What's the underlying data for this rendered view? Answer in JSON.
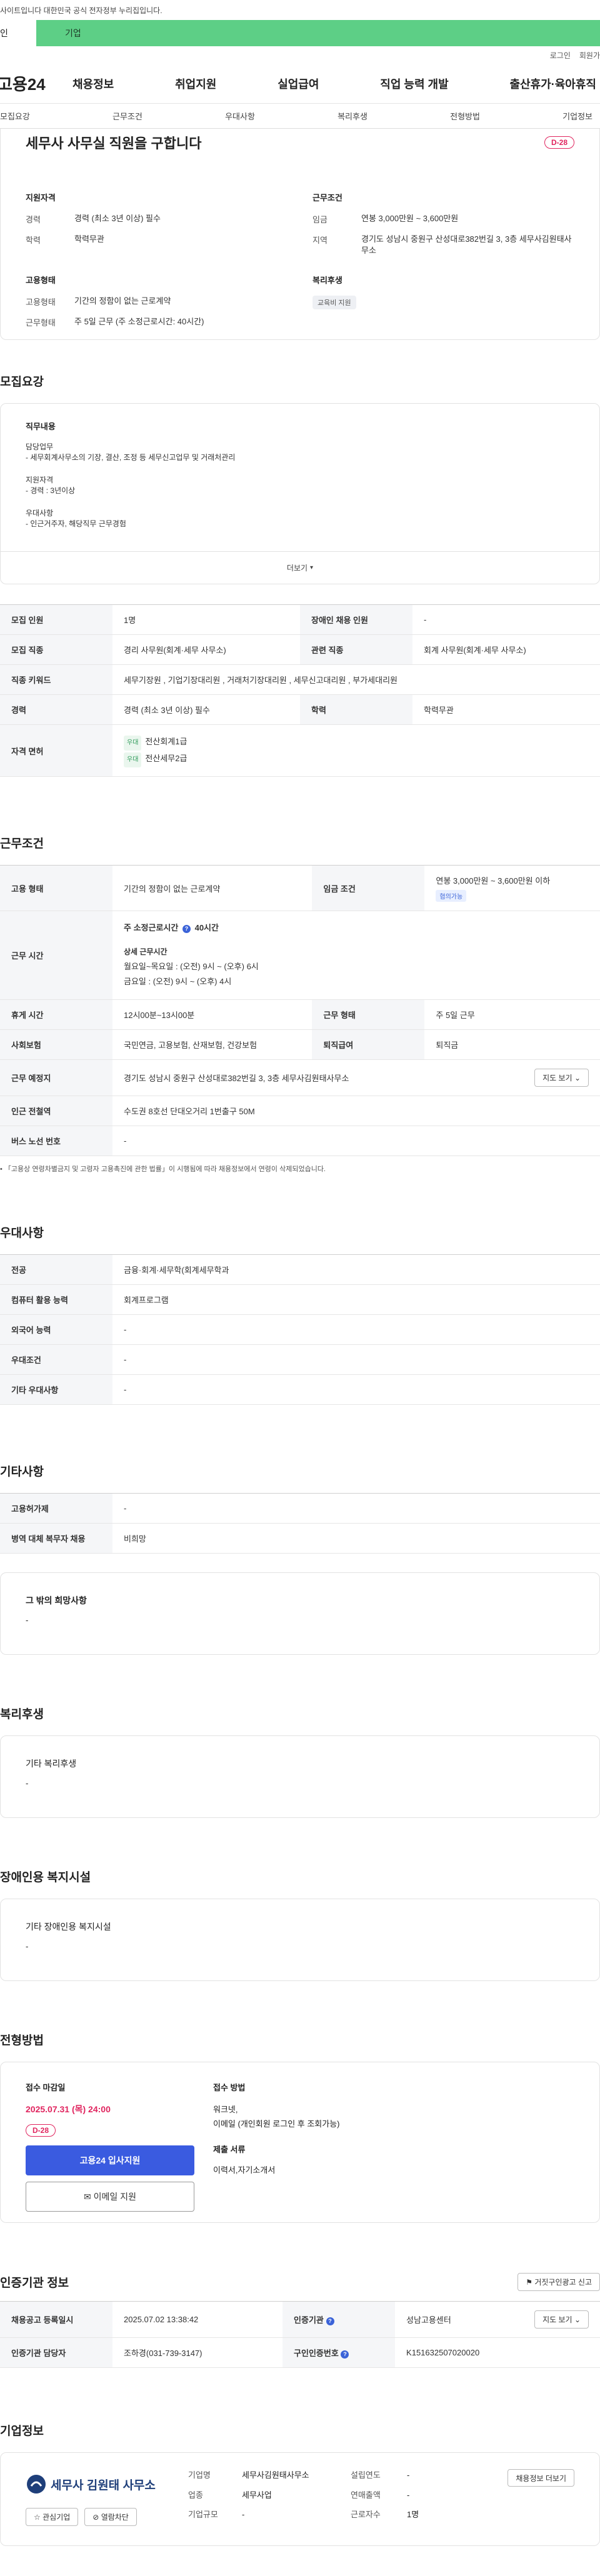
{
  "topbar": {
    "notice": "사이트입니다 대한민국 공식 전자정부 누리집입니다."
  },
  "usertabs": {
    "personal": "인",
    "corporate": "기업"
  },
  "util": {
    "login": "로그인",
    "signup": "회원가"
  },
  "gnb": {
    "logo": "고용24",
    "menu": [
      "채용정보",
      "취업지원",
      "실업급여",
      "직업 능력 개발",
      "출산휴가·육아휴직"
    ]
  },
  "anchors": [
    "모집요강",
    "근무조건",
    "우대사항",
    "복리후생",
    "전형방법",
    "기업정보"
  ],
  "summary": {
    "title": "세무사 사무실 직원을 구합니다",
    "dday": "D-28",
    "qual_title": "지원자격",
    "career_k": "경력",
    "career_v": "경력 (최소 3년 이상) 필수",
    "edu_k": "학력",
    "edu_v": "학력무관",
    "cond_title": "근무조건",
    "pay_k": "임금",
    "pay_v": "연봉 3,000만원 ~ 3,600만원",
    "area_k": "지역",
    "area_v": "경기도 성남시 중원구 산성대로382번길 3, 3층 세무사김원태사무소",
    "emp_title": "고용형태",
    "emptype_k": "고용형태",
    "emptype_v": "기간의 정함이 없는 근로계약",
    "worktype_k": "근무형태",
    "worktype_v": "주 5일 근무 (주 소정근로시간: 40시간)",
    "welfare_title": "복리후생",
    "welfare_chip": "교육비 지원"
  },
  "recruit": {
    "title": "모집요강",
    "duty_title": "직무내용",
    "duty_sub": "담당업무",
    "duty_text": "- 세무회계사무소의 기장, 결산, 조정 등 세무신고업무 및 거래처관리",
    "qual_sub": "지원자격",
    "qual_text": "- 경력 : 3년이상",
    "pref_sub": "우대사항",
    "pref_text": "- 인근거주자, 해당직무 근무경험",
    "more": "더보기",
    "rows": {
      "r1k": "모집 인원",
      "r1v": "1명",
      "r1k2": "장애인 채용 인원",
      "r1v2": "-",
      "r2k": "모집 직종",
      "r2v": "경리 사무원(회계·세무 사무소)",
      "r2k2": "관련 직종",
      "r2v2": "회계 사무원(회계·세무 사무소)",
      "r3k": "직종 키워드",
      "r3v": "세무기장원 , 기업기장대리원 , 거래처기장대리원 , 세무신고대리원 , 부가세대리원",
      "r4k": "경력",
      "r4v": "경력 (최소 3년 이상) 필수",
      "r4k2": "학력",
      "r4v2": "학력무관",
      "r5k": "자격 면허",
      "lic_tag1": "우대",
      "lic1": "전산회계1급",
      "lic_tag2": "우대",
      "lic2": "전산세무2급"
    }
  },
  "workcond": {
    "title": "근무조건",
    "c1k": "고용 형태",
    "c1v": "기간의 정함이 없는 근로계약",
    "c1k2": "임금 조건",
    "c1v2": "연봉 3,000만원 ~ 3,600만원 이하",
    "c1tag": "협의가능",
    "c2k": "근무 시간",
    "c2a": "주 소정근로시간",
    "c2b": "40시간",
    "c2c": "상세 근무시간",
    "c2d": "월요일~목요일 : (오전) 9시 ~ (오후) 6시",
    "c2e": "금요일 : (오전) 9시 ~ (오후) 4시",
    "c3k": "휴게 시간",
    "c3v": "12시00분~13시00분",
    "c3k2": "근무 형태",
    "c3v2": "주 5일 근무",
    "c4k": "사회보험",
    "c4v": "국민연금, 고용보험, 산재보험, 건강보험",
    "c4k2": "퇴직급여",
    "c4v2": "퇴직금",
    "c5k": "근무 예정지",
    "c5v": "경기도 성남시 중원구 산성대로382번길 3, 3층 세무사김원태사무소",
    "c5btn": "지도 보기",
    "c6k": "인근 전철역",
    "c6v": "수도권 8호선 단대오거리 1번출구 50M",
    "c7k": "버스 노선 번호",
    "c7v": "-",
    "note": "「고용상 연령차별금지 및 고령자 고용촉진에 관한 법률」이 시행됨에 따라 채용정보에서 연령이 삭제되었습니다."
  },
  "pref": {
    "title": "우대사항",
    "p1k": "전공",
    "p1v": "금융·회계·세무학(회계세무학과",
    "p2k": "컴퓨터 활용 능력",
    "p2v": "회계프로그램",
    "p3k": "외국어 능력",
    "p3v": "-",
    "p4k": "우대조건",
    "p4v": "-",
    "p5k": "기타 우대사항",
    "p5v": "-"
  },
  "etc": {
    "title": "기타사항",
    "e1k": "고용허가제",
    "e1v": "-",
    "e2k": "병역 대체 복무자 채용",
    "e2v": "비희망",
    "wish_title": "그 밖의 희망사항",
    "wish_v": "-"
  },
  "welfare": {
    "title": "복리후생",
    "sub": "기타 복리후생",
    "v": "-"
  },
  "disabled": {
    "title": "장애인용 복지시설",
    "sub": "기타 장애인용 복지시설",
    "v": "-"
  },
  "process": {
    "title": "전형방법",
    "deadline_k": "접수 마감일",
    "deadline_v": "2025.07.31 (목) 24:00",
    "dday": "D-28",
    "apply_btn": "고용24 입사지원",
    "email_btn": "이메일 지원",
    "method_k": "접수 방법",
    "method_v1": "워크넷,",
    "method_v2": "이메일 (개인회원 로그인 후 조회가능)",
    "docs_k": "제출 서류",
    "docs_v": "이력서,자기소개서"
  },
  "cert": {
    "title": "인증기관 정보",
    "report_btn": "거짓구인광고 신고",
    "k1": "채용공고 등록일시",
    "v1": "2025.07.02 13:38:42",
    "k2": "인증기관",
    "v2": "성남고용센터",
    "map_btn": "지도 보기",
    "k3": "인증기관 담당자",
    "v3": "조하경(031-739-3147)",
    "k4": "구인인증번호",
    "v4": "K151632507020020"
  },
  "company": {
    "title": "기업정보",
    "logo_text": "세무사 김원태 사무소",
    "fav": "관심기업",
    "block": "열람차단",
    "name_k": "기업명",
    "name_v": "세무사김원태사무소",
    "ind_k": "업종",
    "ind_v": "세무사업",
    "scale_k": "기업규모",
    "scale_v": "-",
    "est_k": "설립연도",
    "est_v": "-",
    "sales_k": "연매출액",
    "sales_v": "-",
    "emp_k": "근로자수",
    "emp_v": "1명",
    "more_btn": "채용정보 더보기"
  }
}
